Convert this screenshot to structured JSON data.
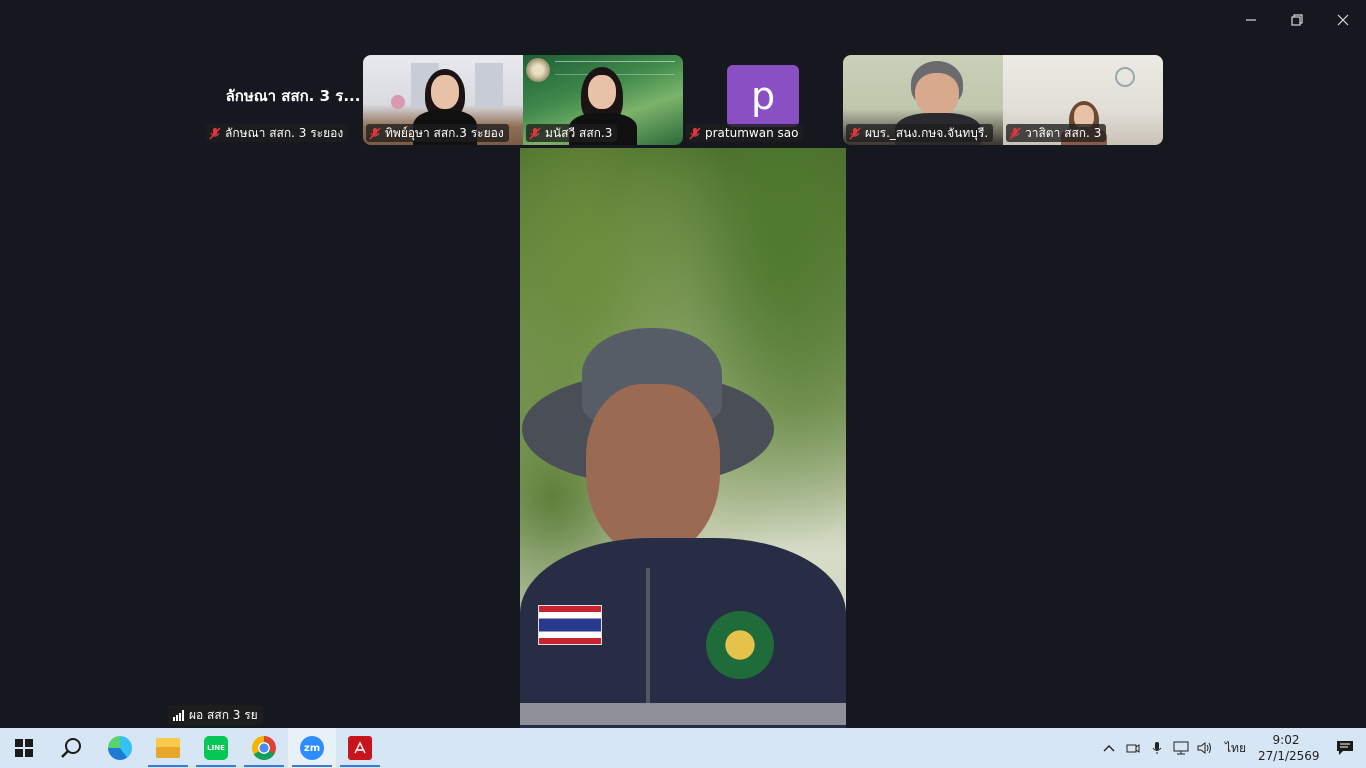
{
  "window": {
    "minimize_icon": "minimize-icon",
    "restore_icon": "restore-icon",
    "close_icon": "close-icon"
  },
  "gallery": {
    "name_only_tile": {
      "display_name": "ลักษณา สสก. 3 ร...",
      "label": "ลักษณา สสก. 3 ระยอง"
    },
    "tiles": [
      {
        "label": "ทิพย์อุษา สสก.3 ระยอง",
        "muted": true
      },
      {
        "label": "มนัสวี สสก.3",
        "muted": true
      },
      {
        "label": "pratumwan sao",
        "muted": true,
        "avatar_letter": "p",
        "avatar_color": "#8a4fc2"
      },
      {
        "label": "ผบร._สนง.กษจ.จันทบุรี.",
        "muted": true
      },
      {
        "label": "วาสิตา สสก. 3",
        "muted": true
      }
    ]
  },
  "active_speaker": {
    "label": "ผอ สสก 3 รย"
  },
  "taskbar": {
    "apps": [
      {
        "name": "start",
        "icon": "windows-icon"
      },
      {
        "name": "search",
        "icon": "search-icon"
      },
      {
        "name": "edge",
        "icon": "edge-icon"
      },
      {
        "name": "file-explorer",
        "icon": "folder-icon"
      },
      {
        "name": "line",
        "icon": "line-icon",
        "text": "LINE"
      },
      {
        "name": "chrome",
        "icon": "chrome-icon"
      },
      {
        "name": "zoom",
        "icon": "zoom-icon",
        "text": "zm"
      },
      {
        "name": "acrobat",
        "icon": "acrobat-icon"
      }
    ],
    "language": "ไทย",
    "time": "9:02",
    "date": "27/1/2569"
  },
  "colors": {
    "background": "#15181e",
    "taskbar": "#d7e6f4",
    "muted_red": "#e0383e",
    "zoom_blue": "#2d8cff"
  }
}
